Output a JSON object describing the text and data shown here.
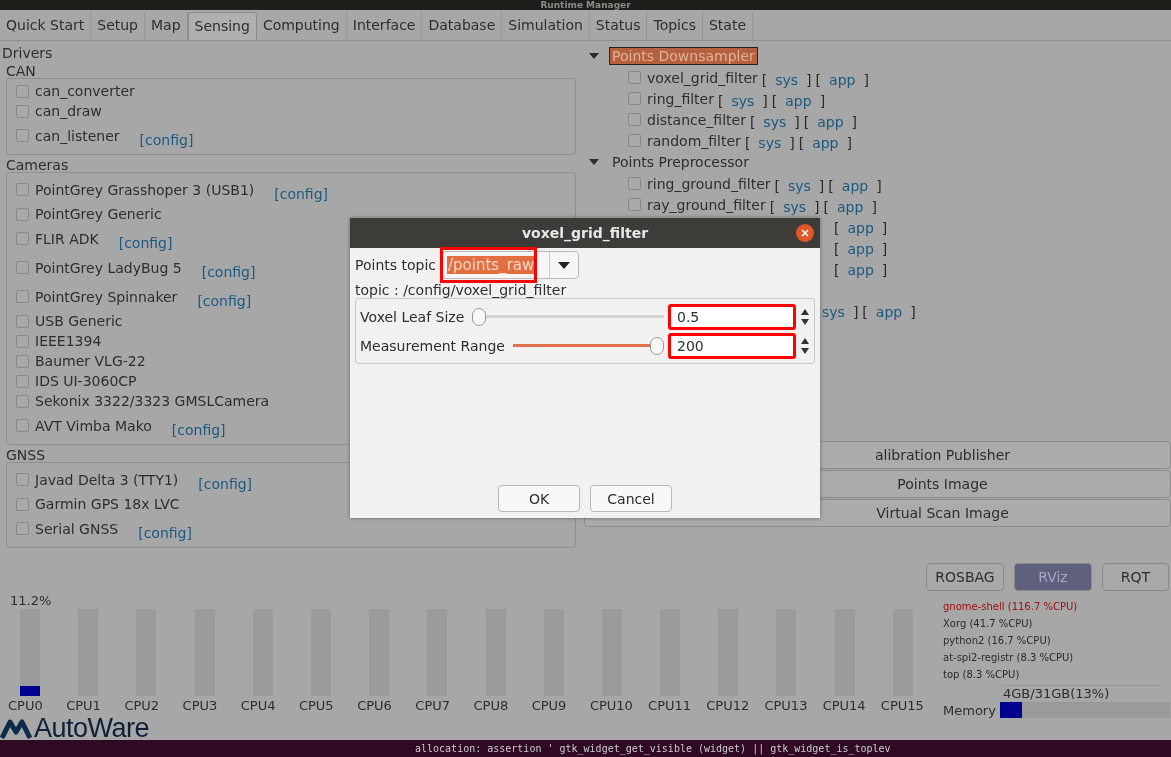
{
  "window": {
    "title": "Runtime Manager"
  },
  "tabs": [
    {
      "label": "Quick Start",
      "selected": false
    },
    {
      "label": "Setup",
      "selected": false
    },
    {
      "label": "Map",
      "selected": false
    },
    {
      "label": "Sensing",
      "selected": true
    },
    {
      "label": "Computing",
      "selected": false
    },
    {
      "label": "Interface",
      "selected": false
    },
    {
      "label": "Database",
      "selected": false
    },
    {
      "label": "Simulation",
      "selected": false
    },
    {
      "label": "Status",
      "selected": false
    },
    {
      "label": "Topics",
      "selected": false
    },
    {
      "label": "State",
      "selected": false
    }
  ],
  "drivers": {
    "title": "Drivers",
    "groups": [
      {
        "title": "CAN",
        "items": [
          {
            "name": "can_converter",
            "checked": false
          },
          {
            "name": "can_draw",
            "checked": false
          },
          {
            "name": "can_listener",
            "checked": false,
            "link": "[config]"
          }
        ]
      },
      {
        "title": "Cameras",
        "items": [
          {
            "name": "PointGrey Grasshoper 3 (USB1)",
            "checked": false,
            "link": "[config]"
          },
          {
            "name": "PointGrey Generic",
            "checked": false
          },
          {
            "name": "FLIR ADK",
            "checked": false,
            "link": "[config]"
          },
          {
            "name": "PointGrey LadyBug 5",
            "checked": false,
            "link": "[config]"
          },
          {
            "name": "PointGrey Spinnaker",
            "checked": false,
            "link": "[config]"
          },
          {
            "name": "USB Generic",
            "checked": false
          },
          {
            "name": "IEEE1394",
            "checked": false
          },
          {
            "name": "Baumer VLG-22",
            "checked": false
          },
          {
            "name": "IDS UI-3060CP",
            "checked": false
          },
          {
            "name": "Sekonix 3322/3323 GMSLCamera",
            "checked": false
          },
          {
            "name": "AVT Vimba Mako",
            "checked": false,
            "link": "[config]"
          }
        ]
      },
      {
        "title": "GNSS",
        "items": [
          {
            "name": "Javad Delta 3 (TTY1)",
            "checked": false,
            "link": "[config]"
          },
          {
            "name": "Garmin GPS 18x LVC",
            "checked": false
          },
          {
            "name": "Serial GNSS",
            "checked": false,
            "link": "[config]"
          }
        ]
      }
    ]
  },
  "tree": [
    {
      "label": "Points Downsampler",
      "expanded": true,
      "selected": true,
      "children": [
        {
          "kind": "node",
          "name": "voxel_grid_filter",
          "checked": false,
          "links": [
            {
              "open": "[",
              "label": "sys",
              "close": "]"
            },
            {
              "open": "[",
              "label": "app",
              "close": "]"
            }
          ]
        },
        {
          "kind": "node",
          "name": "ring_filter",
          "checked": false,
          "links": [
            {
              "open": "[",
              "label": "sys",
              "close": "]"
            },
            {
              "open": "[",
              "label": "app",
              "close": "]"
            }
          ]
        },
        {
          "kind": "node",
          "name": "distance_filter",
          "checked": false,
          "links": [
            {
              "open": "[",
              "label": "sys",
              "close": "]"
            },
            {
              "open": "[",
              "label": "app",
              "close": "]"
            }
          ]
        },
        {
          "kind": "node",
          "name": "random_filter",
          "checked": false,
          "links": [
            {
              "open": "[",
              "label": "sys",
              "close": "]"
            },
            {
              "open": "[",
              "label": "app",
              "close": "]"
            }
          ]
        }
      ]
    },
    {
      "label": "Points Preprocessor",
      "expanded": true,
      "selected": false,
      "children": [
        {
          "kind": "node",
          "name": "ring_ground_filter",
          "checked": false,
          "links": [
            {
              "open": "[",
              "label": "sys",
              "close": "]"
            },
            {
              "open": "[",
              "label": "app",
              "close": "]"
            }
          ]
        },
        {
          "kind": "node",
          "name": "ray_ground_filter",
          "checked": false,
          "links": [
            {
              "open": "[",
              "label": "sys",
              "close": "]"
            },
            {
              "open": "[",
              "label": "app",
              "close": "]"
            }
          ]
        },
        {
          "kind": "covered",
          "links": [
            {
              "open": "[",
              "label": "app",
              "close": "]"
            }
          ]
        },
        {
          "kind": "covered",
          "links": [
            {
              "open": "[",
              "label": "app",
              "close": "]"
            }
          ]
        },
        {
          "kind": "covered",
          "links": [
            {
              "open": "[",
              "label": "app",
              "close": "]"
            }
          ]
        },
        {
          "kind": "blank"
        },
        {
          "kind": "covered",
          "links": [
            {
              "label": "sys",
              "close": "]"
            },
            {
              "open": "[",
              "label": "app",
              "close": "]"
            }
          ]
        }
      ]
    }
  ],
  "wide_buttons": [
    "alibration Publisher",
    "Points Image",
    "Virtual Scan Image"
  ],
  "tool_buttons": [
    {
      "label": "ROSBAG",
      "selected": false
    },
    {
      "label": "RViz",
      "selected": true
    },
    {
      "label": "RQT",
      "selected": false
    }
  ],
  "cpu": {
    "reading": "11.2%",
    "cores": [
      {
        "label": "CPU0",
        "level": 0.11
      },
      {
        "label": "CPU1",
        "level": 0
      },
      {
        "label": "CPU2",
        "level": 0
      },
      {
        "label": "CPU3",
        "level": 0
      },
      {
        "label": "CPU4",
        "level": 0
      },
      {
        "label": "CPU5",
        "level": 0
      },
      {
        "label": "CPU6",
        "level": 0
      },
      {
        "label": "CPU7",
        "level": 0
      },
      {
        "label": "CPU8",
        "level": 0
      },
      {
        "label": "CPU9",
        "level": 0
      },
      {
        "label": "CPU10",
        "level": 0
      },
      {
        "label": "CPU11",
        "level": 0
      },
      {
        "label": "CPU12",
        "level": 0
      },
      {
        "label": "CPU13",
        "level": 0
      },
      {
        "label": "CPU14",
        "level": 0
      },
      {
        "label": "CPU15",
        "level": 0
      }
    ]
  },
  "processes": [
    {
      "text": "gnome-shell (116.7 %CPU)",
      "color": "#a01010"
    },
    {
      "text": "Xorg (41.7 %CPU)",
      "color": "#2a2a2a"
    },
    {
      "text": "python2 (16.7 %CPU)",
      "color": "#2a2a2a"
    },
    {
      "text": "at-spi2-registr (8.3 %CPU)",
      "color": "#2a2a2a"
    },
    {
      "text": "top (8.3 %CPU)",
      "color": "#2a2a2a"
    }
  ],
  "memory": {
    "label": "Memory",
    "reading": "4GB/31GB(13%)",
    "level": 0.13
  },
  "logo": {
    "text": "AutoWare"
  },
  "terminal": {
    "text": "allocation: assertion ' gtk_widget_get_visible (widget) || gtk_widget_is_toplev"
  },
  "dialog": {
    "title": "voxel_grid_filter",
    "topic_label": "Points topic",
    "topic_value": "/points_raw",
    "topic_highlighted": true,
    "frame_title": "topic : /config/voxel_grid_filter",
    "params": [
      {
        "label": "Voxel Leaf Size",
        "level": 0.0,
        "value": "0.5",
        "highlighted": true
      },
      {
        "label": "Measurement Range",
        "level": 1.0,
        "value": "200",
        "highlighted": true
      }
    ],
    "buttons": [
      "OK",
      "Cancel"
    ]
  }
}
